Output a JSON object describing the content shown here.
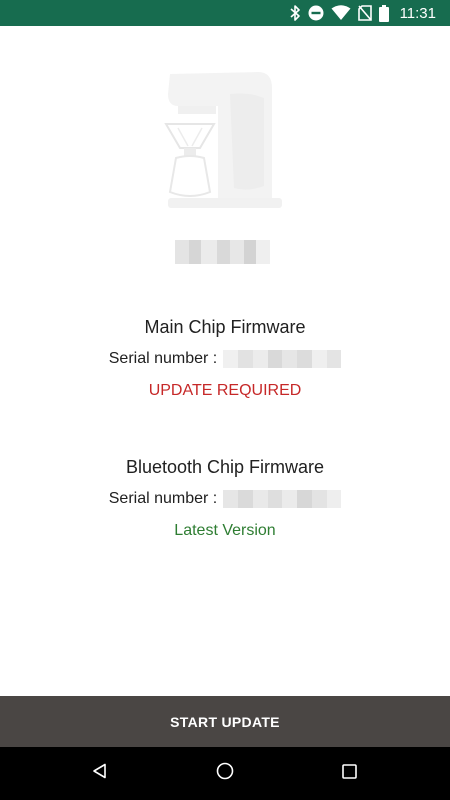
{
  "status_bar": {
    "time": "11:31",
    "background": "#176c4f",
    "icons": [
      "bluetooth-icon",
      "do-not-disturb-icon",
      "wifi-icon",
      "no-sim-icon",
      "battery-icon"
    ]
  },
  "product": {
    "image": "coffee-maker-image"
  },
  "main_chip": {
    "title": "Main Chip Firmware",
    "serial_label": "Serial number :",
    "status": "UPDATE REQUIRED",
    "status_color": "#c62828"
  },
  "bluetooth_chip": {
    "title": "Bluetooth Chip Firmware",
    "serial_label": "Serial number :",
    "status": "Latest Version",
    "status_color": "#2e7d32"
  },
  "action": {
    "start_update_label": "START UPDATE",
    "background": "#4a4644"
  },
  "nav_bar": {
    "icons": [
      "back-icon",
      "home-icon",
      "recents-icon"
    ]
  }
}
